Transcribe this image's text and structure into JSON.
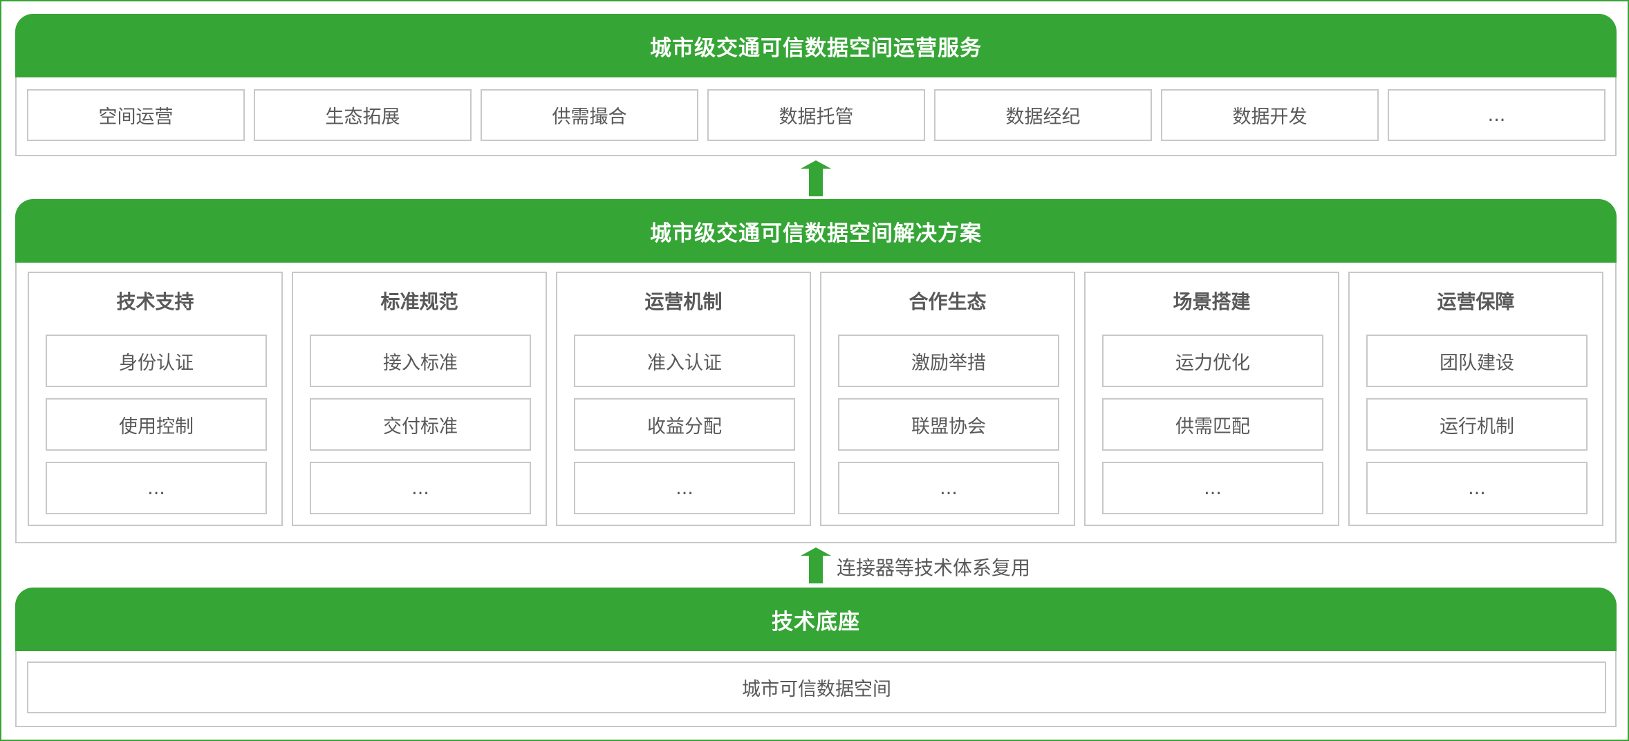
{
  "colors": {
    "accent": "#35a535",
    "border": "#c8c8c8",
    "text": "#595959"
  },
  "top_section": {
    "title": "城市级交通可信数据空间运营服务",
    "items": [
      "空间运营",
      "生态拓展",
      "供需撮合",
      "数据托管",
      "数据经纪",
      "数据开发",
      "..."
    ]
  },
  "middle_section": {
    "title": "城市级交通可信数据空间解决方案",
    "columns": [
      {
        "title": "技术支持",
        "items": [
          "身份认证",
          "使用控制",
          "..."
        ]
      },
      {
        "title": "标准规范",
        "items": [
          "接入标准",
          "交付标准",
          "..."
        ]
      },
      {
        "title": "运营机制",
        "items": [
          "准入认证",
          "收益分配",
          "..."
        ]
      },
      {
        "title": "合作生态",
        "items": [
          "激励举措",
          "联盟协会",
          "..."
        ]
      },
      {
        "title": "场景搭建",
        "items": [
          "运力优化",
          "供需匹配",
          "..."
        ]
      },
      {
        "title": "运营保障",
        "items": [
          "团队建设",
          "运行机制",
          "..."
        ]
      }
    ]
  },
  "arrow_lower": {
    "label": "连接器等技术体系复用"
  },
  "bottom_section": {
    "title": "技术底座",
    "item": "城市可信数据空间"
  }
}
